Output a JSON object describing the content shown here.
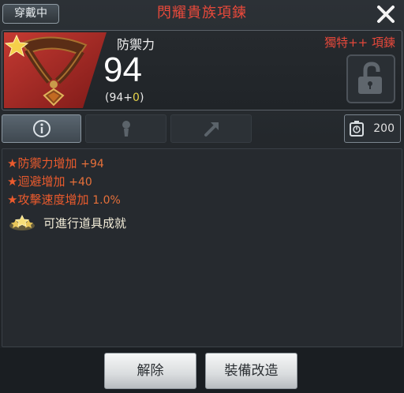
{
  "header": {
    "equipped_label": "穿戴中",
    "item_name": "閃耀貴族項鍊"
  },
  "item": {
    "stat_label": "防禦力",
    "stat_value": "94",
    "stat_base": "(94+",
    "stat_bonus": "0",
    "stat_close": ")",
    "grade_label": "獨特++ 項鍊",
    "grade_color": "#e5483b"
  },
  "tabs": [
    {
      "icon": "info-icon",
      "active": true
    },
    {
      "icon": "figure-icon",
      "active": false
    },
    {
      "icon": "upgrade-arrow-icon",
      "active": false
    }
  ],
  "weight": {
    "icon": "weight-icon",
    "value": "200"
  },
  "effects": [
    {
      "star": "★",
      "label": "防禦力增加",
      "amount": "+94"
    },
    {
      "star": "★",
      "label": "迴避增加",
      "amount": "+40"
    },
    {
      "star": "★",
      "label": "攻擊速度增加",
      "amount": "1.0%"
    }
  ],
  "achievement": {
    "icon": "achievement-stars-icon",
    "text": "可進行道具成就"
  },
  "buttons": {
    "unequip": "解除",
    "modify": "裝備改造"
  }
}
